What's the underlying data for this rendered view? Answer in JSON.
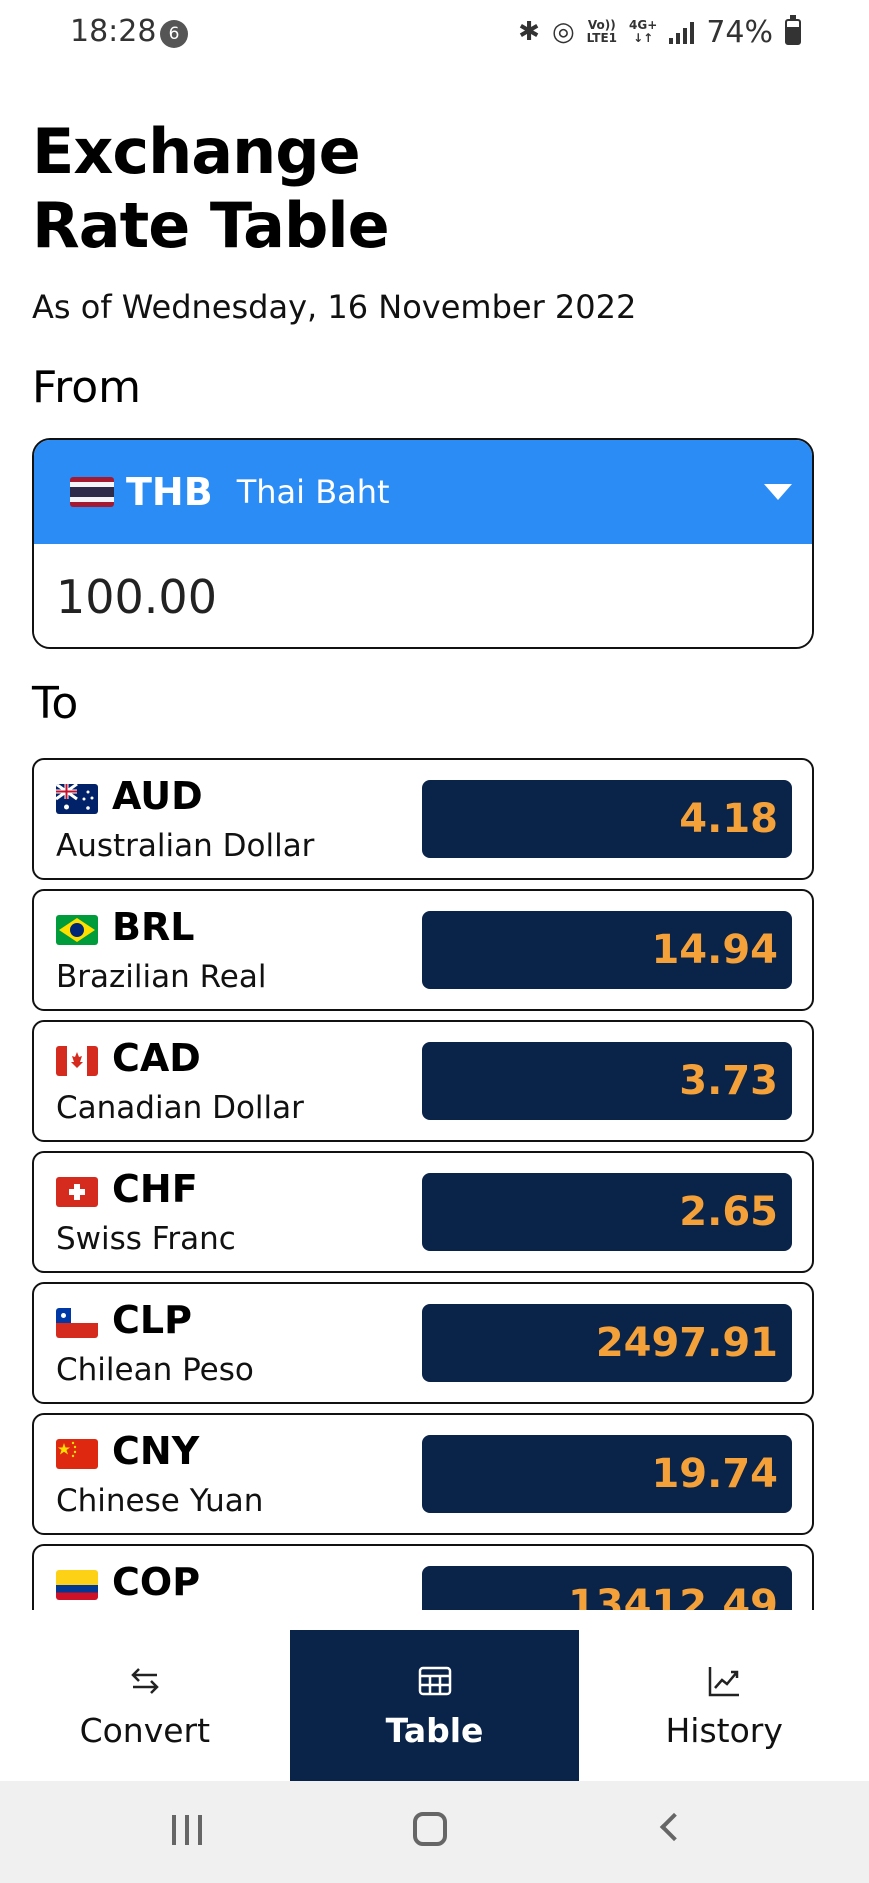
{
  "status_bar": {
    "time": "18:28",
    "notification_count": "6",
    "lte_top": "Vo))",
    "lte_bottom": "LTE1",
    "network_top": "4G+",
    "network_bottom": "↓↑",
    "battery": "74%"
  },
  "header": {
    "title": "Exchange Rate Table",
    "as_of": "As of Wednesday, 16 November 2022"
  },
  "from": {
    "label": "From",
    "code": "THB",
    "name": "Thai Baht",
    "amount": "100.00"
  },
  "to": {
    "label": "To",
    "rates": [
      {
        "code": "AUD",
        "name": "Australian Dollar",
        "value": "4.18",
        "flag": "australia-flag-icon"
      },
      {
        "code": "BRL",
        "name": "Brazilian Real",
        "value": "14.94",
        "flag": "brazil-flag-icon"
      },
      {
        "code": "CAD",
        "name": "Canadian Dollar",
        "value": "3.73",
        "flag": "canada-flag-icon"
      },
      {
        "code": "CHF",
        "name": "Swiss Franc",
        "value": "2.65",
        "flag": "switzerland-flag-icon"
      },
      {
        "code": "CLP",
        "name": "Chilean Peso",
        "value": "2497.91",
        "flag": "chile-flag-icon"
      },
      {
        "code": "CNY",
        "name": "Chinese Yuan",
        "value": "19.74",
        "flag": "china-flag-icon"
      },
      {
        "code": "COP",
        "name": "",
        "value": "13412.49",
        "flag": "colombia-flag-icon"
      }
    ]
  },
  "nav": {
    "convert": "Convert",
    "table": "Table",
    "history": "History"
  },
  "colors": {
    "accent_blue": "#2b8cf6",
    "navy": "#0a2348",
    "rate_orange": "#f4a13a"
  }
}
